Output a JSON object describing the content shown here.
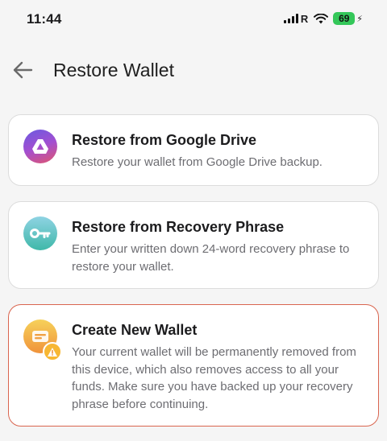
{
  "status_bar": {
    "time": "11:44",
    "carrier_indicator": "R",
    "battery_level": "69",
    "icons": [
      "signal-icon",
      "wifi-icon",
      "battery-icon",
      "charging-bolt-icon"
    ]
  },
  "header": {
    "title": "Restore Wallet",
    "back_icon": "back-arrow-icon"
  },
  "options": [
    {
      "title": "Restore from Google Drive",
      "description": "Restore your wallet from Google Drive backup.",
      "icon": "google-drive-icon"
    },
    {
      "title": "Restore from Recovery Phrase",
      "description": "Enter your written down 24-word recovery phrase to restore your wallet.",
      "icon": "key-icon"
    },
    {
      "title": "Create New Wallet",
      "description": "Your current wallet will be permanently removed from this device, which also removes access to all your funds. Make sure you have backed up your recovery phrase before continuing.",
      "icon": "new-wallet-icon",
      "badge_icon": "warning-icon"
    }
  ],
  "colors": {
    "background": "#f5f5f5",
    "warning_border": "#d9654f",
    "battery": "#34c759"
  }
}
